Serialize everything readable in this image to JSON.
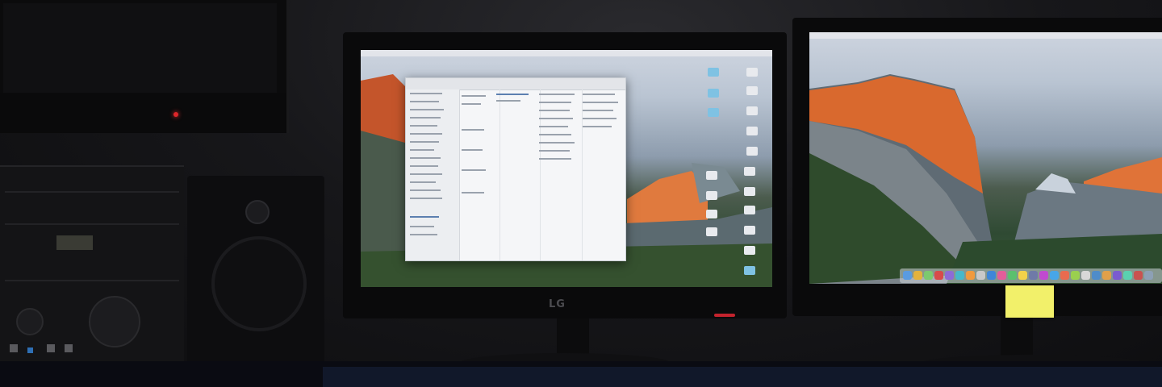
{
  "scene": "",
  "left_monitor": {
    "logo": "LG",
    "top_logo": "",
    "finder_window": {
      "title": ""
    }
  },
  "right_monitor": {
    "top_logo": ""
  },
  "dock_app_colors": [
    "#5a9be0",
    "#e3b23c",
    "#7cc96f",
    "#d84b4b",
    "#8e6bd6",
    "#47b8c9",
    "#f09a3e",
    "#c9c9c9",
    "#3f86d8",
    "#e35d9a",
    "#5ac06e",
    "#f2d24a",
    "#6f7aa8",
    "#c04ad0",
    "#47a6e8",
    "#e86b4f",
    "#9ad04f",
    "#d8d8d8",
    "#4f8cc9",
    "#e0a04a",
    "#7a5bd0",
    "#5ad0b0",
    "#c9524f",
    "#8da0b5"
  ],
  "sticky_note_color": "#f2f06a",
  "power_led_color": "#c3232d"
}
